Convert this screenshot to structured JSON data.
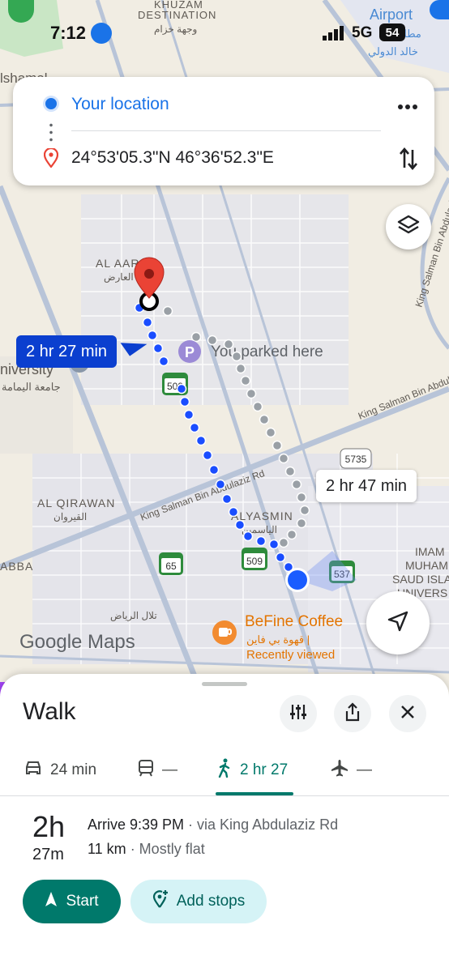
{
  "status_bar": {
    "time": "7:12",
    "network": "5G",
    "battery": "54"
  },
  "search_card": {
    "origin": "Your location",
    "destination": "24°53'05.3\"N 46°36'52.3\"E"
  },
  "map": {
    "labels": {
      "khuzam": "KHUZAM",
      "destination": "DESTINATION",
      "destination_ar": "وجهة خزام",
      "airport": "Airport",
      "airport_ar1": "مطار",
      "airport_ar2": "خالد الدولي",
      "alshamal": "lshamal",
      "al_aarid": "AL AARID",
      "al_aarid_ar": "العارض",
      "university1": "niversity",
      "university_ar": "جامعة اليمامة",
      "parked": "You parked here",
      "salman_rd_right": "King Salman Bin Abdulaziz Rd",
      "salman_rd_left": "King Salman Bin Abdulaziz Rd",
      "abdulaziz_rd": "King Salman Bin Abdulaziz Rd",
      "al_qirawan": "AL QIRAWAN",
      "al_qirawan_ar": "القيروان",
      "alyasmin": "ALYASMIN",
      "alyasmin_ar": "الياسمين",
      "abba": "ABBA",
      "riyadh_ar": "تلال الرياض",
      "imam1": "IMAM",
      "imam2": "MUHAMMA",
      "imam3": "SAUD ISLA",
      "imam4": "UNIVERS",
      "shield_509a": "509",
      "shield_509b": "509",
      "shield_5735": "5735",
      "shield_65": "65",
      "shield_537": "537",
      "google_maps": "Google Maps"
    },
    "route_labels": {
      "primary": "2 hr 27 min",
      "alternate": "2 hr 47 min"
    },
    "poi": {
      "name": "BeFine Coffee",
      "name_ar": "قهوة بي فاين |",
      "note": "Recently viewed"
    },
    "colors": {
      "route": "#1a4dff",
      "alternate_route": "#9aa0a6",
      "selected_label_bg": "#0b3fcf",
      "pin": "#ea4335"
    }
  },
  "sheet": {
    "mode_title": "Walk",
    "tabs": [
      {
        "icon": "car-icon",
        "label": "24 min"
      },
      {
        "icon": "transit-icon",
        "label": "—"
      },
      {
        "icon": "walk-icon",
        "label": "2 hr 27"
      },
      {
        "icon": "flight-icon",
        "label": "—"
      }
    ],
    "duration_hours": "2h",
    "duration_minutes": "27m",
    "arrive": "Arrive 9:39 PM",
    "via": " · via King Abdulaziz Rd",
    "distance": "11 km",
    "terrain": " · Mostly flat",
    "start_label": "Start",
    "add_stops_label": "Add stops",
    "accent": "#00796b"
  }
}
